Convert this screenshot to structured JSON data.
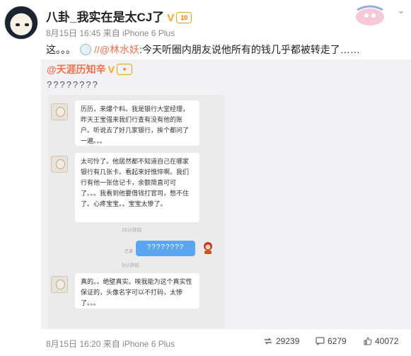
{
  "header": {
    "username": "八卦_我实在是太CJ了",
    "verified": "V",
    "level": "10",
    "meta": "8月15日 16:45 来自 iPhone 6 Plus"
  },
  "post": {
    "prefix": "这。。。",
    "mention_sep": "//",
    "mention": "@林水妖",
    "body": ":今天听圈内朋友说他所有的钱几乎都被转走了……"
  },
  "repost": {
    "author": "@天涯历知辛",
    "text": "????????"
  },
  "chat": {
    "msg1": "历历，来爆个料。我是银行大堂经理，昨天王宝强来我们行查有没有他的账户。听说去了好几家银行，挨个都问了一遍。。。",
    "msg2": "太可怜了。他居然都不知道自己在哪家银行有几张卡。看起来好憔悴啊。我们行有他一张信记卡，余额简直可可了。。。我看到他要借钱打官司，憋不住了。心疼宝宝。。宝宝太惨了。",
    "time1": "16分钟前",
    "read": "已读",
    "my_msg": "????????",
    "time2": "9分钟前",
    "msg3": "真的。。绝壁真实。唉我能为这个真实性保证的，头像名字可以不打码，太惨了。。。"
  },
  "footer": {
    "meta": "8月15日 16:20 来自 iPhone 6 Plus",
    "reposts": "29239",
    "comments": "6279",
    "likes": "40072"
  },
  "colors": {
    "mention": "#eb7350",
    "repost_bg": "#f2f2f5",
    "chat_bubble_self": "#5aa7f0"
  }
}
